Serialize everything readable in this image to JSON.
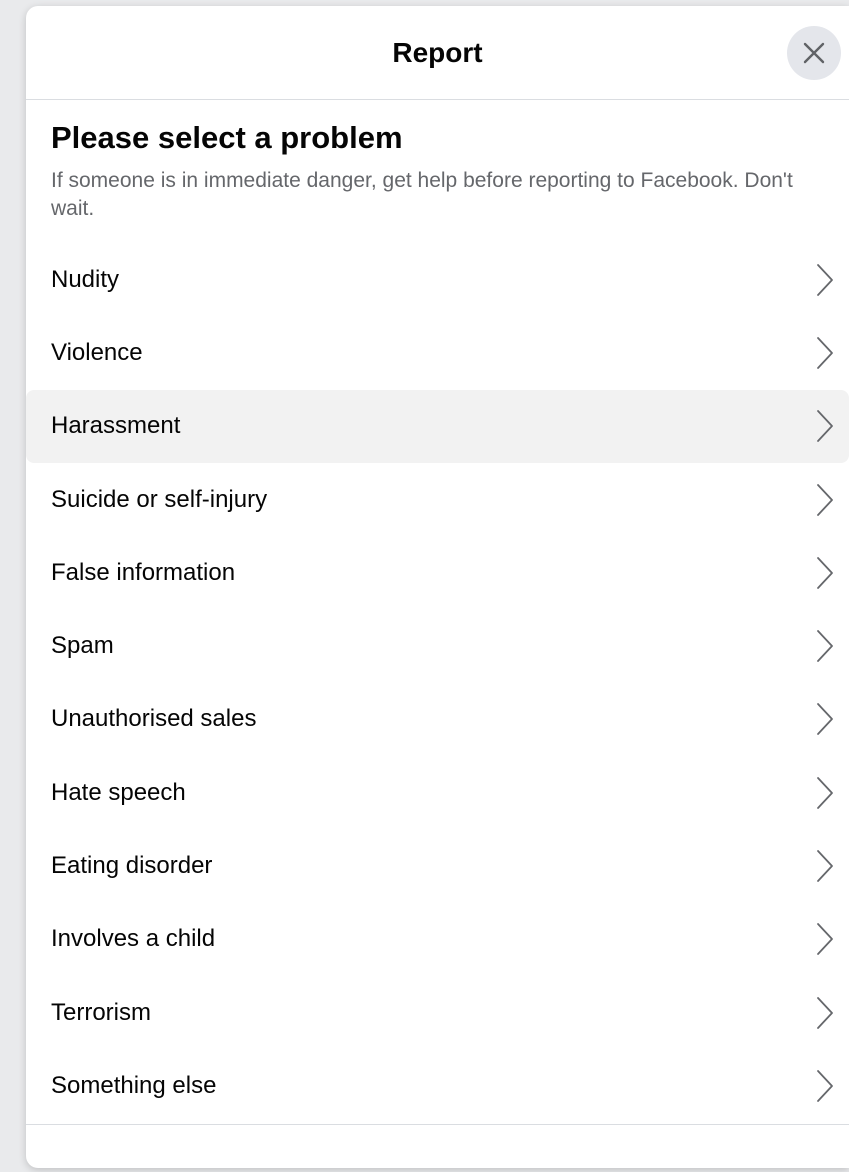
{
  "dialog": {
    "title": "Report",
    "close_icon": "close-icon"
  },
  "intro": {
    "heading": "Please select a problem",
    "subtext": "If someone is in immediate danger, get help before reporting to Facebook. Don't wait."
  },
  "problems": [
    {
      "label": "Nudity"
    },
    {
      "label": "Violence"
    },
    {
      "label": "Harassment"
    },
    {
      "label": "Suicide or self-injury"
    },
    {
      "label": "False information"
    },
    {
      "label": "Spam"
    },
    {
      "label": "Unauthorised sales"
    },
    {
      "label": "Hate speech"
    },
    {
      "label": "Eating disorder"
    },
    {
      "label": "Involves a child"
    },
    {
      "label": "Terrorism"
    },
    {
      "label": "Something else"
    }
  ],
  "hovered_item": "Harassment",
  "colors": {
    "text_primary": "#050505",
    "text_secondary": "#65676b",
    "close_bg": "#e4e6eb",
    "hover_bg": "#f2f2f2",
    "divider": "#dadde1"
  }
}
